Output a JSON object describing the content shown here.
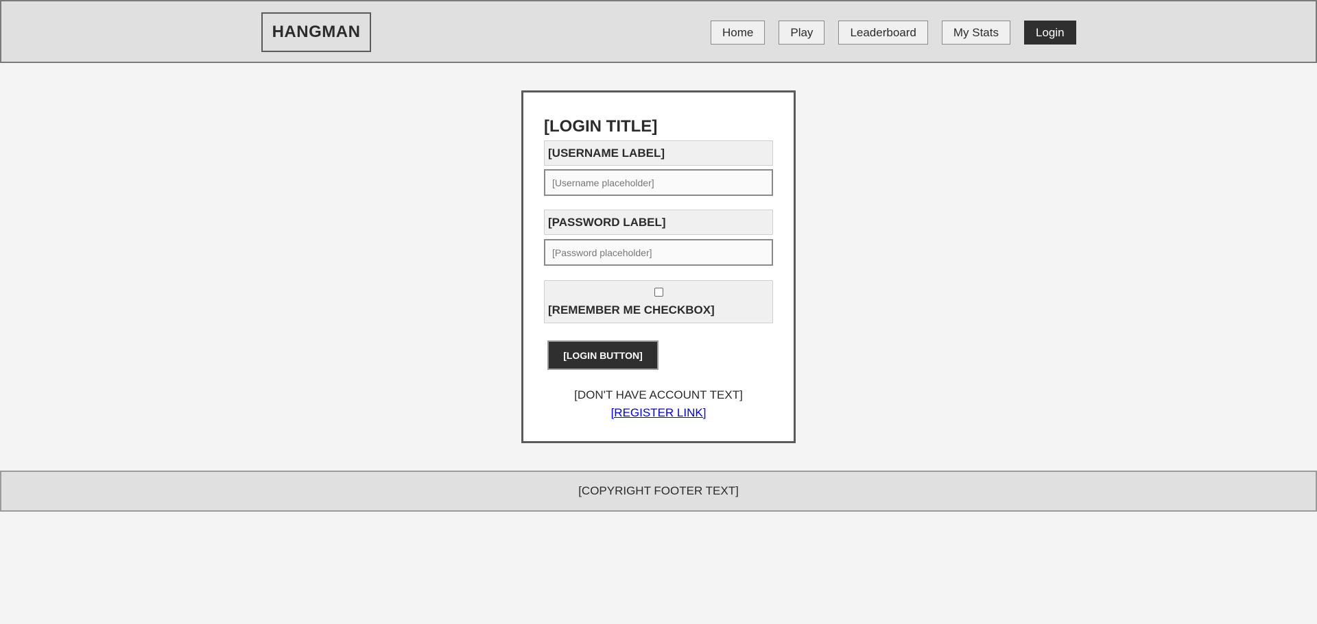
{
  "header": {
    "logo": "HANGMAN",
    "nav": [
      {
        "label": "Home"
      },
      {
        "label": "Play"
      },
      {
        "label": "Leaderboard"
      },
      {
        "label": "My Stats"
      },
      {
        "label": "Login",
        "active": true
      }
    ]
  },
  "login": {
    "title": "[LOGIN TITLE]",
    "username_label": "[USERNAME LABEL]",
    "username_placeholder": "[Username placeholder]",
    "password_label": "[PASSWORD LABEL]",
    "password_placeholder": "[Password placeholder]",
    "remember_label": "[REMEMBER ME CHECKBOX]",
    "remember_checked": false,
    "login_button": "[LOGIN BUTTON]",
    "no_account_text": "[DON'T HAVE ACCOUNT TEXT]",
    "register_link": "[REGISTER LINK]"
  },
  "footer": {
    "copyright": "[COPYRIGHT FOOTER TEXT]"
  },
  "colors": {
    "header_bg": "#e0e0e0",
    "page_bg": "#f4f4f4",
    "active_nav": "#2f2f2f",
    "link": "#0000ee"
  }
}
